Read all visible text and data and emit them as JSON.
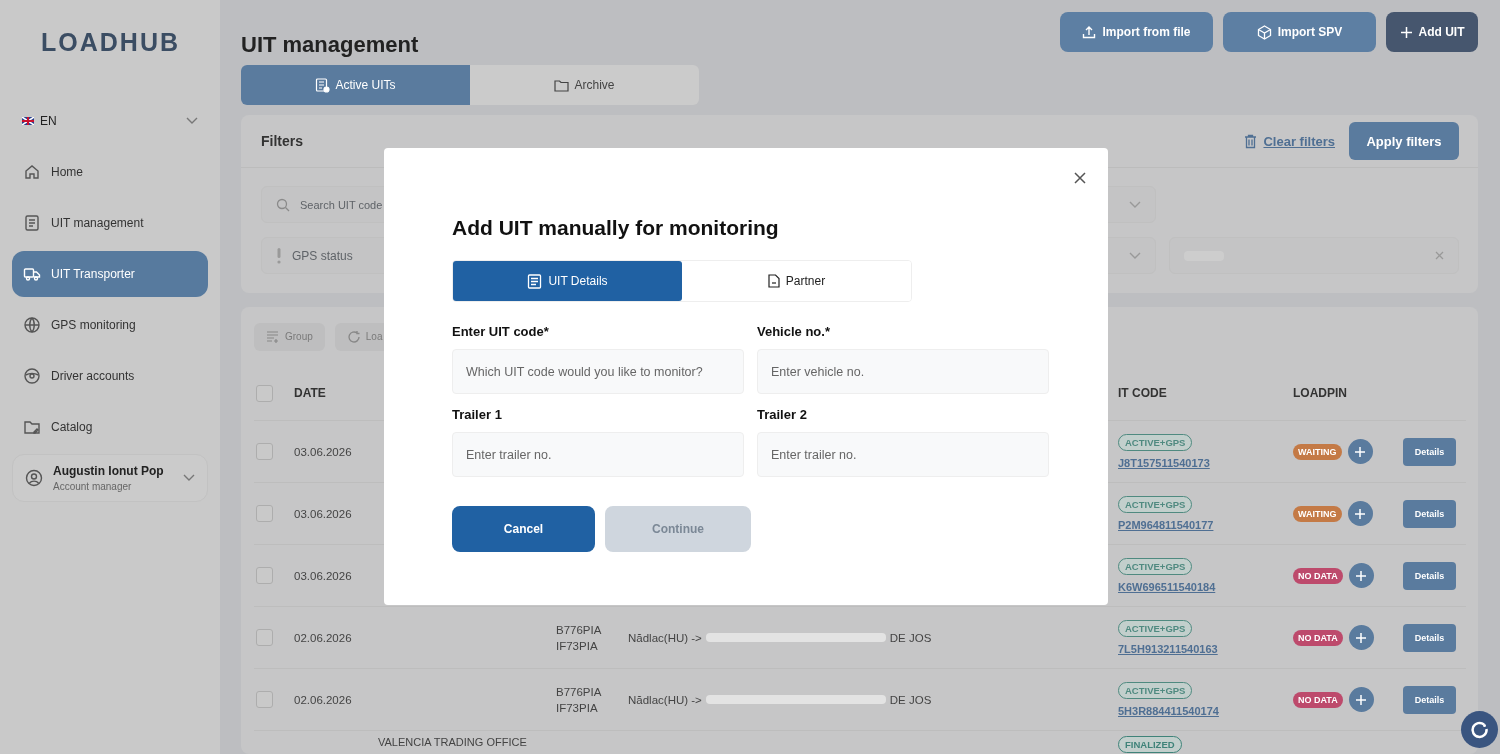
{
  "sidebar": {
    "logo": "LOADHUB",
    "language": "EN",
    "nav": [
      {
        "label": "Home",
        "selected": false
      },
      {
        "label": "UIT management",
        "selected": false
      },
      {
        "label": "UIT Transporter",
        "selected": true
      },
      {
        "label": "GPS monitoring",
        "selected": false
      },
      {
        "label": "Driver accounts",
        "selected": false
      },
      {
        "label": "Catalog",
        "selected": false
      }
    ],
    "user": {
      "name": "Augustin Ionut Pop",
      "role": "Account manager"
    }
  },
  "header": {
    "title": "UIT management",
    "actions": [
      {
        "label": "Import from file",
        "kind": "upload"
      },
      {
        "label": "Import SPV",
        "kind": "spv"
      },
      {
        "label": "Add UIT",
        "kind": "add"
      }
    ]
  },
  "view_tabs": [
    {
      "label": "Active UITs",
      "selected": true
    },
    {
      "label": "Archive",
      "selected": false
    }
  ],
  "filters": {
    "title": "Filters",
    "clear_label": "Clear filters",
    "apply_label": "Apply filters",
    "search_placeholder": "Search UIT code",
    "gps_placeholder": "GPS status"
  },
  "toolbar": [
    "Group",
    "Loa"
  ],
  "table": {
    "select_all_checked": false,
    "columns": [
      "DATE",
      "IT CODE",
      "LOADPIN"
    ],
    "rows": [
      {
        "checked": false,
        "date": "03.06.2026",
        "uit_status": {
          "label": "ACTIVE+GPS",
          "color": "#4f8a80"
        },
        "uit_code": "J8T157511540173",
        "loadpin": {
          "label": "WAITING",
          "color": "#c47a46"
        },
        "details": "Details"
      },
      {
        "checked": false,
        "date": "03.06.2026",
        "uit_status": {
          "label": "ACTIVE+GPS",
          "color": "#4f8a80"
        },
        "uit_code": "P2M964811540177",
        "loadpin": {
          "label": "WAITING",
          "color": "#c47a46"
        },
        "details": "Details"
      },
      {
        "checked": false,
        "date": "03.06.2026",
        "uit_status": {
          "label": "ACTIVE+GPS",
          "color": "#4f8a80"
        },
        "uit_code": "K6W696511540184",
        "loadpin": {
          "label": "NO DATA",
          "color": "#bd4a6c"
        },
        "details": "Details"
      },
      {
        "checked": false,
        "date": "02.06.2026",
        "vehicle": [
          "B776PIA",
          "IF73PIA"
        ],
        "route_start": "Nădlac(HU) ->",
        "route_end": "DE JOS",
        "uit_status": {
          "label": "ACTIVE+GPS",
          "color": "#4f8a80"
        },
        "uit_code": "7L5H913211540163",
        "loadpin": {
          "label": "NO DATA",
          "color": "#bd4a6c"
        },
        "details": "Details"
      },
      {
        "checked": false,
        "date": "02.06.2026",
        "vehicle": [
          "B776PIA",
          "IF73PIA"
        ],
        "route_start": "Nădlac(HU) ->",
        "route_end": "DE JOS",
        "uit_status": {
          "label": "ACTIVE+GPS",
          "color": "#4f8a80"
        },
        "uit_code": "5H3R884411540174",
        "loadpin": {
          "label": "NO DATA",
          "color": "#bd4a6c"
        },
        "details": "Details"
      },
      {
        "client": "VALENCIA TRADING OFFICE",
        "uit_status": {
          "label": "FINALIZED",
          "color": "#3f8379"
        }
      }
    ]
  },
  "modal": {
    "title": "Add UIT manually for monitoring",
    "tabs": [
      {
        "label": "UIT Details",
        "selected": true
      },
      {
        "label": "Partner",
        "selected": false
      }
    ],
    "fields": [
      {
        "label": "Enter UIT code*",
        "placeholder": "Which UIT code would you like to monitor?"
      },
      {
        "label": "Vehicle no.*",
        "placeholder": "Enter vehicle no."
      },
      {
        "label": "Trailer 1",
        "placeholder": "Enter trailer no."
      },
      {
        "label": "Trailer 2",
        "placeholder": "Enter trailer no."
      }
    ],
    "cancel": "Cancel",
    "continue": {
      "label": "Continue",
      "disabled": true
    }
  }
}
